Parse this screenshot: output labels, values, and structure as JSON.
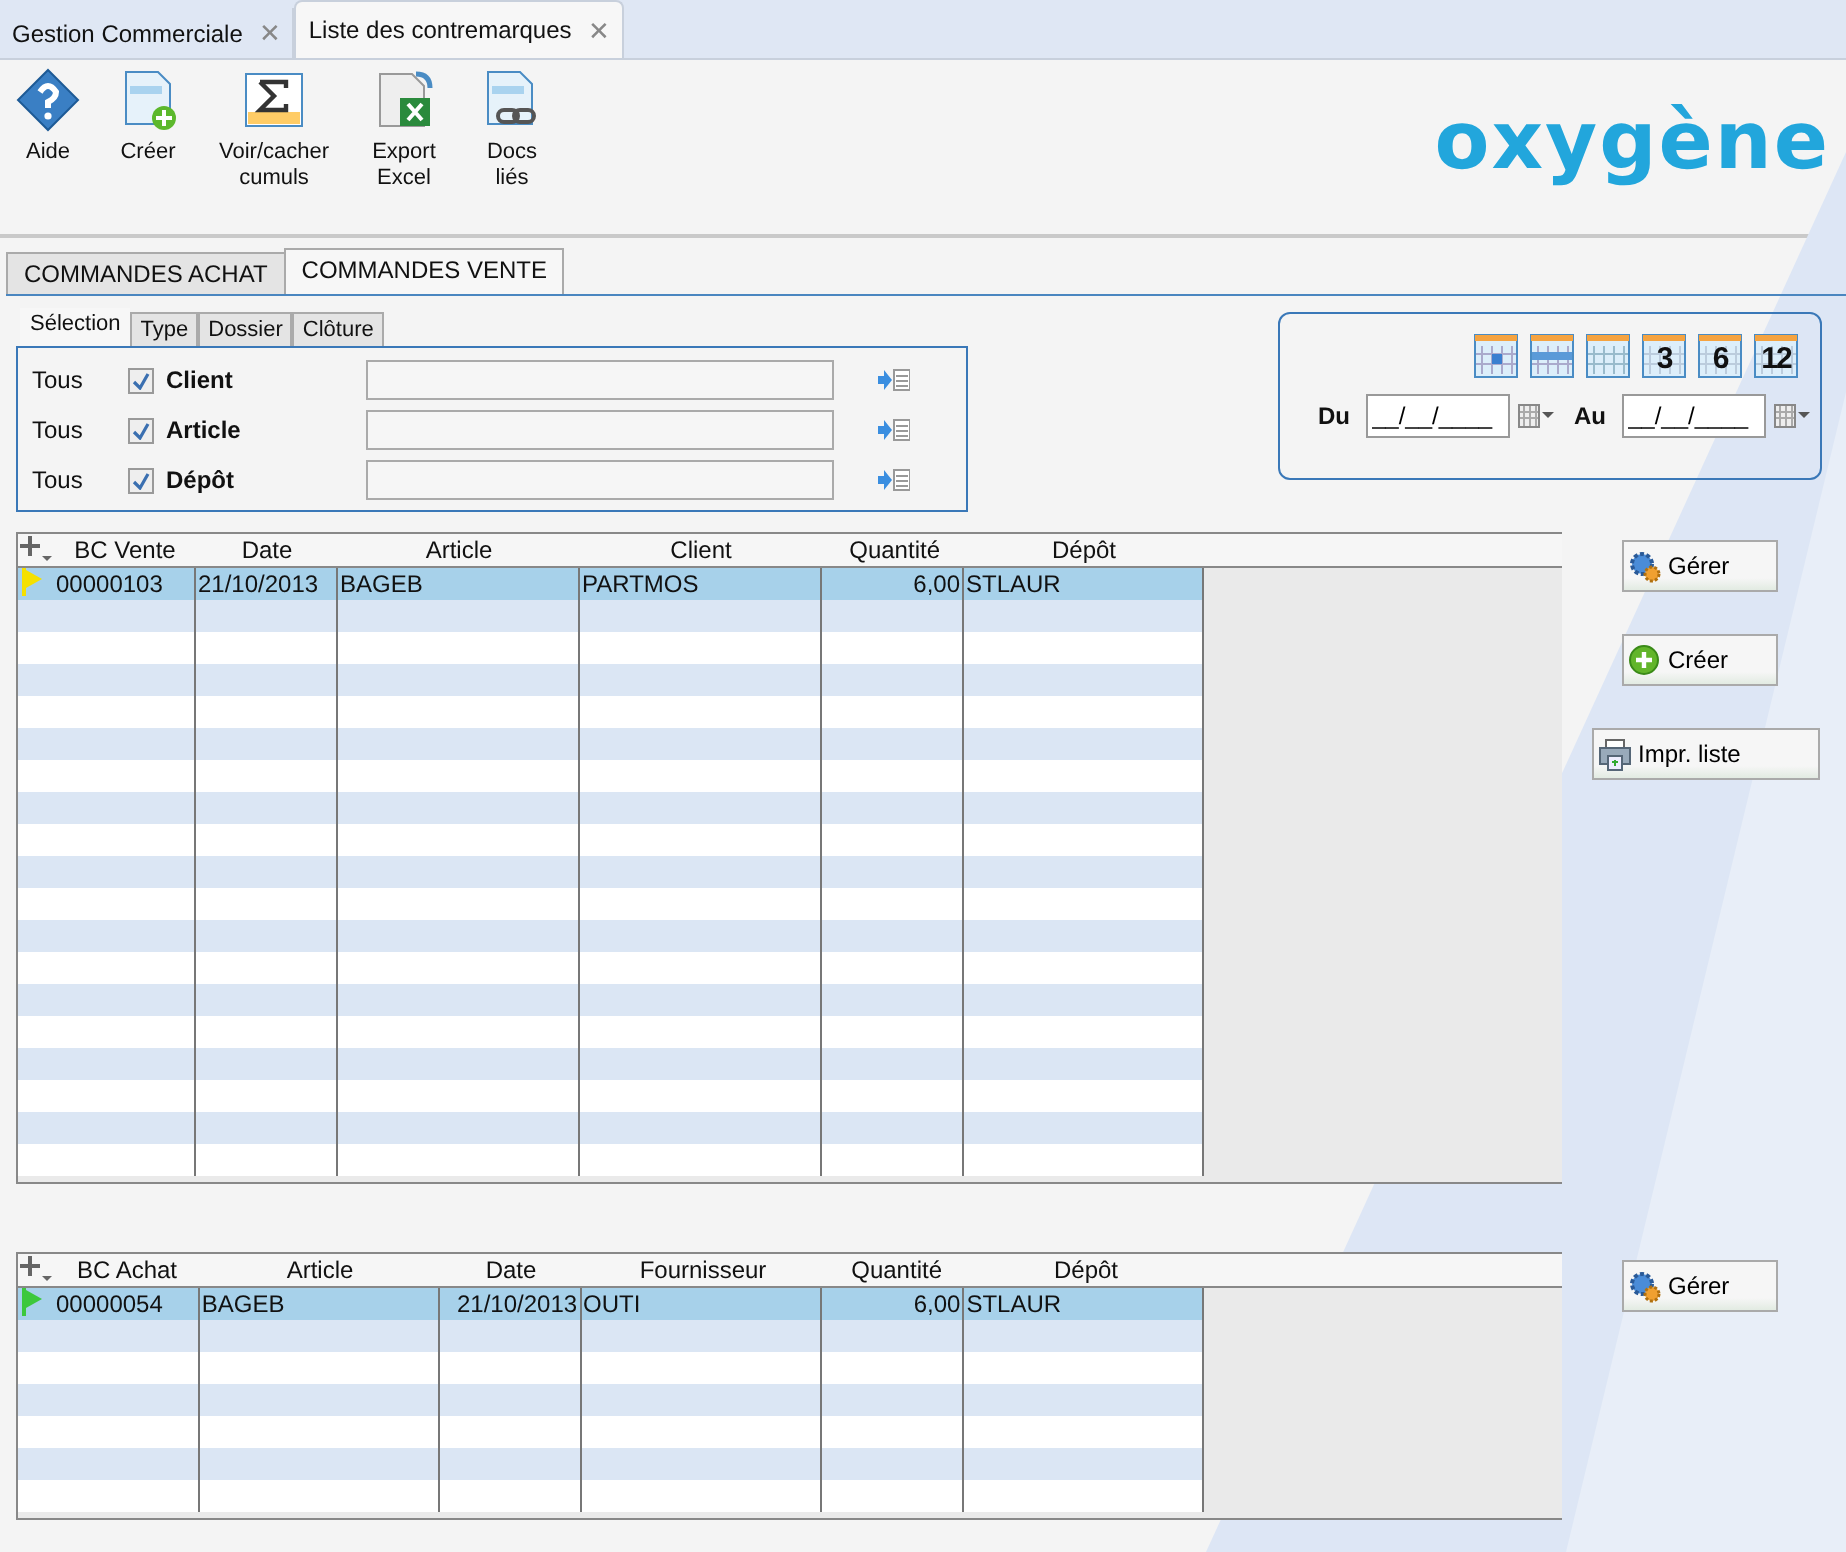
{
  "doc_tabs": [
    {
      "label": "Gestion Commerciale",
      "selected": false,
      "close": "✕"
    },
    {
      "label": "Liste des contremarques",
      "selected": true,
      "close": "✕"
    }
  ],
  "toolbar": [
    {
      "kind": "help",
      "label": "Aide"
    },
    {
      "kind": "create",
      "label": "Créer"
    },
    {
      "kind": "sum",
      "label": "Voir/cacher cumuls"
    },
    {
      "kind": "excel",
      "label": "Export Excel"
    },
    {
      "kind": "link",
      "label": "Docs liés"
    }
  ],
  "logo": "oxygène",
  "main_tabs": [
    {
      "label": "COMMANDES ACHAT",
      "selected": false
    },
    {
      "label": "COMMANDES VENTE",
      "selected": true
    }
  ],
  "filter_tabs": [
    {
      "label": "Sélection",
      "selected": true
    },
    {
      "label": "Type",
      "selected": false
    },
    {
      "label": "Dossier",
      "selected": false
    },
    {
      "label": "Clôture",
      "selected": false
    }
  ],
  "filters": [
    {
      "all": "Tous",
      "checked": true,
      "label": "Client"
    },
    {
      "all": "Tous",
      "checked": true,
      "label": "Article"
    },
    {
      "all": "Tous",
      "checked": true,
      "label": "Dépôt"
    }
  ],
  "period_buttons": [
    {
      "kind": "day"
    },
    {
      "kind": "week"
    },
    {
      "kind": "month"
    },
    {
      "kind": "number",
      "label": "3"
    },
    {
      "kind": "number",
      "label": "6"
    },
    {
      "kind": "number",
      "label": "12"
    }
  ],
  "date_from": {
    "label": "Du",
    "placeholder": "__/__/____"
  },
  "date_to": {
    "label": "Au",
    "placeholder": "__/__/____"
  },
  "sales_grid": {
    "columns": [
      "BC Vente",
      "Date",
      "Article",
      "Client",
      "Quantité",
      "Dépôt"
    ],
    "rows": [
      {
        "cells": [
          "00000103",
          "21/10/2013",
          "BAGEB",
          "PARTMOS",
          "6,00",
          "STLAUR"
        ],
        "color": "#f5e000",
        "selected": true
      }
    ]
  },
  "sales_buttons": [
    {
      "kind": "manage",
      "label": "Gérer"
    },
    {
      "kind": "create",
      "label": "Créer"
    },
    {
      "kind": "print",
      "label": "Impr. liste"
    }
  ],
  "purchase_grid": {
    "columns": [
      "BC Achat",
      "Article",
      "Date",
      "Fournisseur",
      "Quantité",
      "Dépôt"
    ],
    "rows": [
      {
        "cells": [
          "00000054",
          "BAGEB",
          "21/10/2013",
          "OUTI",
          "6,00",
          "STLAUR"
        ],
        "color": "#3cc83c",
        "selected": true
      }
    ]
  },
  "purchase_buttons": [
    {
      "kind": "manage",
      "label": "Gérer"
    }
  ]
}
